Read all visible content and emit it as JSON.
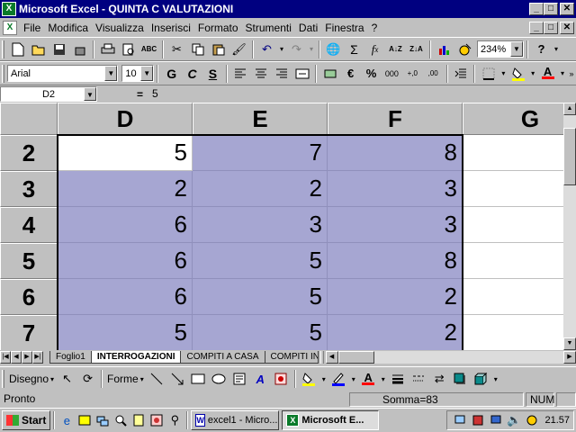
{
  "window": {
    "title": "Microsoft Excel - QUINTA C VALUTAZIONI",
    "app_icon": "X",
    "buttons": [
      "_",
      "□",
      "✕"
    ]
  },
  "menu": {
    "items": [
      "File",
      "Modifica",
      "Visualizza",
      "Inserisci",
      "Formato",
      "Strumenti",
      "Dati",
      "Finestra",
      "?"
    ],
    "doc_buttons": [
      "_",
      "□",
      "✕"
    ]
  },
  "toolbar": {
    "zoom": "234%",
    "help": "?"
  },
  "format": {
    "font": "Arial",
    "size": "10",
    "bold": "G",
    "italic": "C",
    "underline": "S",
    "currency": "€",
    "percent": "%",
    "thousands": "000"
  },
  "formula": {
    "name_box": "D2",
    "equals": "=",
    "value": "5"
  },
  "grid": {
    "columns": [
      "D",
      "E",
      "F",
      "G"
    ],
    "rows": [
      {
        "row": "2",
        "cells": [
          "5",
          "7",
          "8",
          ""
        ]
      },
      {
        "row": "3",
        "cells": [
          "2",
          "2",
          "3",
          ""
        ]
      },
      {
        "row": "4",
        "cells": [
          "6",
          "3",
          "3",
          ""
        ]
      },
      {
        "row": "5",
        "cells": [
          "6",
          "5",
          "8",
          ""
        ]
      },
      {
        "row": "6",
        "cells": [
          "6",
          "5",
          "2",
          ""
        ]
      },
      {
        "row": "7",
        "cells": [
          "5",
          "5",
          "2",
          ""
        ]
      }
    ],
    "selection_color": "#a6a6d2"
  },
  "sheets": {
    "tabs": [
      "Foglio1",
      "INTERROGAZIONI",
      "COMPITI A CASA",
      "COMPITI IN"
    ],
    "active": "INTERROGAZIONI"
  },
  "drawbar": {
    "draw": "Disegno",
    "shapes": "Forme"
  },
  "status": {
    "ready": "Pronto",
    "sum": "Somma=83",
    "num": "NUM"
  },
  "taskbar": {
    "start": "Start",
    "tasks": [
      "excel1 - Micro...",
      "Microsoft E..."
    ],
    "clock": "21.57"
  }
}
